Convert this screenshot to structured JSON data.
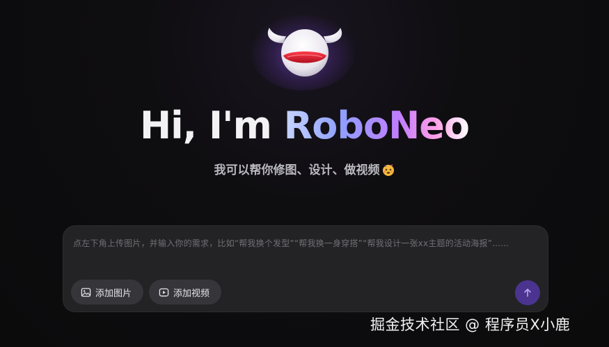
{
  "brand": {
    "greeting": "Hi, I'm ",
    "name": "RoboNeo",
    "accent_gradient": [
      "#c7d4ff",
      "#8fa0ff",
      "#c07dff",
      "#ff9fe6",
      "#ffffff"
    ]
  },
  "subtitle": "我可以帮你修图、设计、做视频",
  "subtitle_emoji": "starstruck-face-icon",
  "composer": {
    "placeholder": "点左下角上传图片，并输入你的需求，比如“帮我换个发型”“帮我换一身穿搭”“帮我设计一张xx主题的活动海报”......",
    "add_image_label": "添加图片",
    "add_image_icon": "image-icon",
    "add_video_label": "添加视频",
    "add_video_icon": "video-icon",
    "send_icon": "arrow-up-icon",
    "send_color": "#4a348f"
  },
  "watermark": "掘金技术社区 @ 程序员X小鹿",
  "colors": {
    "background": "#0d0d0e",
    "card": "#232326",
    "chip": "#35353a"
  }
}
